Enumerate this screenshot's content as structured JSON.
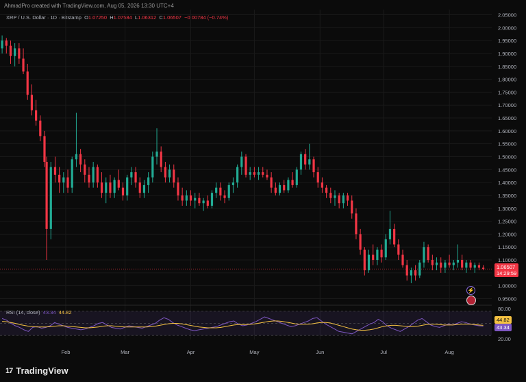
{
  "credit": "AhmadPro created with TradingView.com, Aug 05, 2026 13:30 UTC+4",
  "legend": {
    "symbol": "XRP / U.S. Dollar · 1D · Bitstamp",
    "o_label": "O",
    "o": "1.07250",
    "h_label": "H",
    "h": "1.07584",
    "l_label": "L",
    "l": "1.06312",
    "c_label": "C",
    "c": "1.06507",
    "change": "−0.00784 (−0.74%)"
  },
  "price_badge": {
    "price": "1.06507",
    "countdown": "14:29:59"
  },
  "rsi": {
    "label": "RSI (14, close)",
    "rsi_value": "43.34",
    "ma_value": "44.82",
    "axis_ticks": [
      "80.00",
      "20.00"
    ]
  },
  "brand": {
    "logo": "17",
    "name": "TradingView"
  },
  "icons": {
    "flash": "flash-icon",
    "flag": "us-flag-icon"
  },
  "colors": {
    "up": "#22ab94",
    "down": "#f23645",
    "rsi": "#7e57c2",
    "rsi_ma": "#f5c242",
    "background": "#0b0b0b"
  },
  "chart_data": {
    "type": "candlestick",
    "price_axis_ticks": [
      "2.05000",
      "2.00000",
      "1.95000",
      "1.90000",
      "1.85000",
      "1.80000",
      "1.75000",
      "1.70000",
      "1.65000",
      "1.60000",
      "1.55000",
      "1.50000",
      "1.45000",
      "1.40000",
      "1.35000",
      "1.30000",
      "1.25000",
      "1.20000",
      "1.15000",
      "1.10000",
      "1.05000",
      "1.00000",
      "0.95000"
    ],
    "price_range": [
      0.93,
      2.07
    ],
    "x_axis_labels": [
      "Feb",
      "Mar",
      "Apr",
      "May",
      "Jun",
      "Jul",
      "Aug"
    ],
    "x_label_days": [
      31,
      59,
      90,
      120,
      151,
      181,
      212
    ],
    "x_range_days": [
      0,
      232
    ],
    "last_close": 1.06507,
    "candles": [
      {
        "d": 1,
        "o": 1.92,
        "h": 1.97,
        "l": 1.9,
        "c": 1.95
      },
      {
        "d": 3,
        "o": 1.95,
        "h": 1.96,
        "l": 1.9,
        "c": 1.93
      },
      {
        "d": 5,
        "o": 1.93,
        "h": 1.95,
        "l": 1.86,
        "c": 1.89
      },
      {
        "d": 7,
        "o": 1.89,
        "h": 1.94,
        "l": 1.85,
        "c": 1.92
      },
      {
        "d": 9,
        "o": 1.92,
        "h": 1.94,
        "l": 1.86,
        "c": 1.88
      },
      {
        "d": 11,
        "o": 1.88,
        "h": 1.92,
        "l": 1.82,
        "c": 1.83
      },
      {
        "d": 13,
        "o": 1.83,
        "h": 1.86,
        "l": 1.72,
        "c": 1.74
      },
      {
        "d": 15,
        "o": 1.74,
        "h": 1.78,
        "l": 1.66,
        "c": 1.68
      },
      {
        "d": 17,
        "o": 1.68,
        "h": 1.72,
        "l": 1.62,
        "c": 1.64
      },
      {
        "d": 19,
        "o": 1.64,
        "h": 1.66,
        "l": 1.56,
        "c": 1.58
      },
      {
        "d": 21,
        "o": 1.58,
        "h": 1.6,
        "l": 1.46,
        "c": 1.48
      },
      {
        "d": 22,
        "o": 1.48,
        "h": 1.5,
        "l": 1.1,
        "c": 1.22
      },
      {
        "d": 24,
        "o": 1.22,
        "h": 1.48,
        "l": 1.18,
        "c": 1.46
      },
      {
        "d": 26,
        "o": 1.46,
        "h": 1.5,
        "l": 1.4,
        "c": 1.43
      },
      {
        "d": 28,
        "o": 1.43,
        "h": 1.46,
        "l": 1.36,
        "c": 1.4
      },
      {
        "d": 30,
        "o": 1.4,
        "h": 1.44,
        "l": 1.36,
        "c": 1.42
      },
      {
        "d": 32,
        "o": 1.42,
        "h": 1.45,
        "l": 1.36,
        "c": 1.38
      },
      {
        "d": 34,
        "o": 1.38,
        "h": 1.5,
        "l": 1.36,
        "c": 1.49
      },
      {
        "d": 36,
        "o": 1.49,
        "h": 1.67,
        "l": 1.46,
        "c": 1.51
      },
      {
        "d": 38,
        "o": 1.51,
        "h": 1.53,
        "l": 1.44,
        "c": 1.47
      },
      {
        "d": 40,
        "o": 1.47,
        "h": 1.49,
        "l": 1.4,
        "c": 1.43
      },
      {
        "d": 42,
        "o": 1.43,
        "h": 1.46,
        "l": 1.38,
        "c": 1.4
      },
      {
        "d": 44,
        "o": 1.4,
        "h": 1.48,
        "l": 1.38,
        "c": 1.46
      },
      {
        "d": 46,
        "o": 1.46,
        "h": 1.47,
        "l": 1.38,
        "c": 1.4
      },
      {
        "d": 48,
        "o": 1.4,
        "h": 1.44,
        "l": 1.34,
        "c": 1.36
      },
      {
        "d": 50,
        "o": 1.36,
        "h": 1.42,
        "l": 1.32,
        "c": 1.4
      },
      {
        "d": 52,
        "o": 1.4,
        "h": 1.43,
        "l": 1.34,
        "c": 1.36
      },
      {
        "d": 54,
        "o": 1.36,
        "h": 1.42,
        "l": 1.34,
        "c": 1.41
      },
      {
        "d": 56,
        "o": 1.41,
        "h": 1.45,
        "l": 1.37,
        "c": 1.38
      },
      {
        "d": 58,
        "o": 1.38,
        "h": 1.4,
        "l": 1.33,
        "c": 1.35
      },
      {
        "d": 60,
        "o": 1.35,
        "h": 1.43,
        "l": 1.33,
        "c": 1.42
      },
      {
        "d": 62,
        "o": 1.42,
        "h": 1.46,
        "l": 1.39,
        "c": 1.44
      },
      {
        "d": 64,
        "o": 1.44,
        "h": 1.46,
        "l": 1.38,
        "c": 1.4
      },
      {
        "d": 66,
        "o": 1.4,
        "h": 1.42,
        "l": 1.34,
        "c": 1.36
      },
      {
        "d": 68,
        "o": 1.36,
        "h": 1.41,
        "l": 1.34,
        "c": 1.39
      },
      {
        "d": 70,
        "o": 1.39,
        "h": 1.44,
        "l": 1.36,
        "c": 1.42
      },
      {
        "d": 72,
        "o": 1.42,
        "h": 1.52,
        "l": 1.4,
        "c": 1.5
      },
      {
        "d": 74,
        "o": 1.5,
        "h": 1.61,
        "l": 1.47,
        "c": 1.52
      },
      {
        "d": 76,
        "o": 1.52,
        "h": 1.54,
        "l": 1.44,
        "c": 1.46
      },
      {
        "d": 78,
        "o": 1.46,
        "h": 1.48,
        "l": 1.4,
        "c": 1.42
      },
      {
        "d": 80,
        "o": 1.42,
        "h": 1.47,
        "l": 1.4,
        "c": 1.45
      },
      {
        "d": 82,
        "o": 1.45,
        "h": 1.47,
        "l": 1.38,
        "c": 1.4
      },
      {
        "d": 84,
        "o": 1.4,
        "h": 1.42,
        "l": 1.33,
        "c": 1.35
      },
      {
        "d": 86,
        "o": 1.35,
        "h": 1.38,
        "l": 1.31,
        "c": 1.33
      },
      {
        "d": 88,
        "o": 1.33,
        "h": 1.37,
        "l": 1.31,
        "c": 1.35
      },
      {
        "d": 90,
        "o": 1.35,
        "h": 1.37,
        "l": 1.31,
        "c": 1.33
      },
      {
        "d": 92,
        "o": 1.33,
        "h": 1.36,
        "l": 1.3,
        "c": 1.34
      },
      {
        "d": 94,
        "o": 1.34,
        "h": 1.36,
        "l": 1.31,
        "c": 1.32
      },
      {
        "d": 96,
        "o": 1.32,
        "h": 1.34,
        "l": 1.29,
        "c": 1.33
      },
      {
        "d": 98,
        "o": 1.33,
        "h": 1.35,
        "l": 1.3,
        "c": 1.31
      },
      {
        "d": 100,
        "o": 1.31,
        "h": 1.37,
        "l": 1.3,
        "c": 1.36
      },
      {
        "d": 102,
        "o": 1.36,
        "h": 1.4,
        "l": 1.34,
        "c": 1.38
      },
      {
        "d": 104,
        "o": 1.38,
        "h": 1.4,
        "l": 1.33,
        "c": 1.35
      },
      {
        "d": 106,
        "o": 1.35,
        "h": 1.37,
        "l": 1.32,
        "c": 1.34
      },
      {
        "d": 108,
        "o": 1.34,
        "h": 1.4,
        "l": 1.33,
        "c": 1.39
      },
      {
        "d": 110,
        "o": 1.39,
        "h": 1.42,
        "l": 1.36,
        "c": 1.4
      },
      {
        "d": 112,
        "o": 1.4,
        "h": 1.47,
        "l": 1.38,
        "c": 1.46
      },
      {
        "d": 114,
        "o": 1.46,
        "h": 1.52,
        "l": 1.43,
        "c": 1.5
      },
      {
        "d": 116,
        "o": 1.5,
        "h": 1.51,
        "l": 1.42,
        "c": 1.43
      },
      {
        "d": 118,
        "o": 1.43,
        "h": 1.46,
        "l": 1.41,
        "c": 1.44
      },
      {
        "d": 120,
        "o": 1.44,
        "h": 1.46,
        "l": 1.42,
        "c": 1.43
      },
      {
        "d": 122,
        "o": 1.43,
        "h": 1.46,
        "l": 1.41,
        "c": 1.44
      },
      {
        "d": 124,
        "o": 1.44,
        "h": 1.46,
        "l": 1.42,
        "c": 1.43
      },
      {
        "d": 126,
        "o": 1.43,
        "h": 1.45,
        "l": 1.41,
        "c": 1.42
      },
      {
        "d": 128,
        "o": 1.42,
        "h": 1.44,
        "l": 1.36,
        "c": 1.38
      },
      {
        "d": 130,
        "o": 1.38,
        "h": 1.4,
        "l": 1.35,
        "c": 1.36
      },
      {
        "d": 132,
        "o": 1.36,
        "h": 1.4,
        "l": 1.35,
        "c": 1.39
      },
      {
        "d": 134,
        "o": 1.39,
        "h": 1.41,
        "l": 1.36,
        "c": 1.37
      },
      {
        "d": 136,
        "o": 1.37,
        "h": 1.42,
        "l": 1.36,
        "c": 1.41
      },
      {
        "d": 138,
        "o": 1.41,
        "h": 1.44,
        "l": 1.38,
        "c": 1.39
      },
      {
        "d": 140,
        "o": 1.39,
        "h": 1.46,
        "l": 1.38,
        "c": 1.45
      },
      {
        "d": 142,
        "o": 1.45,
        "h": 1.52,
        "l": 1.43,
        "c": 1.51
      },
      {
        "d": 144,
        "o": 1.51,
        "h": 1.53,
        "l": 1.45,
        "c": 1.47
      },
      {
        "d": 146,
        "o": 1.47,
        "h": 1.55,
        "l": 1.45,
        "c": 1.49
      },
      {
        "d": 148,
        "o": 1.49,
        "h": 1.5,
        "l": 1.42,
        "c": 1.44
      },
      {
        "d": 150,
        "o": 1.44,
        "h": 1.46,
        "l": 1.38,
        "c": 1.4
      },
      {
        "d": 152,
        "o": 1.4,
        "h": 1.42,
        "l": 1.36,
        "c": 1.38
      },
      {
        "d": 154,
        "o": 1.38,
        "h": 1.39,
        "l": 1.34,
        "c": 1.36
      },
      {
        "d": 156,
        "o": 1.36,
        "h": 1.38,
        "l": 1.32,
        "c": 1.34
      },
      {
        "d": 158,
        "o": 1.34,
        "h": 1.37,
        "l": 1.31,
        "c": 1.35
      },
      {
        "d": 160,
        "o": 1.35,
        "h": 1.36,
        "l": 1.3,
        "c": 1.32
      },
      {
        "d": 162,
        "o": 1.32,
        "h": 1.36,
        "l": 1.3,
        "c": 1.35
      },
      {
        "d": 164,
        "o": 1.35,
        "h": 1.36,
        "l": 1.31,
        "c": 1.33
      },
      {
        "d": 166,
        "o": 1.33,
        "h": 1.35,
        "l": 1.26,
        "c": 1.28
      },
      {
        "d": 168,
        "o": 1.28,
        "h": 1.3,
        "l": 1.18,
        "c": 1.2
      },
      {
        "d": 170,
        "o": 1.2,
        "h": 1.22,
        "l": 1.12,
        "c": 1.14
      },
      {
        "d": 172,
        "o": 1.14,
        "h": 1.15,
        "l": 1.04,
        "c": 1.06
      },
      {
        "d": 174,
        "o": 1.06,
        "h": 1.14,
        "l": 1.05,
        "c": 1.12
      },
      {
        "d": 176,
        "o": 1.12,
        "h": 1.16,
        "l": 1.08,
        "c": 1.1
      },
      {
        "d": 178,
        "o": 1.1,
        "h": 1.15,
        "l": 1.08,
        "c": 1.14
      },
      {
        "d": 180,
        "o": 1.14,
        "h": 1.16,
        "l": 1.09,
        "c": 1.11
      },
      {
        "d": 182,
        "o": 1.11,
        "h": 1.2,
        "l": 1.1,
        "c": 1.18
      },
      {
        "d": 184,
        "o": 1.18,
        "h": 1.29,
        "l": 1.16,
        "c": 1.22
      },
      {
        "d": 186,
        "o": 1.22,
        "h": 1.24,
        "l": 1.15,
        "c": 1.16
      },
      {
        "d": 188,
        "o": 1.16,
        "h": 1.18,
        "l": 1.1,
        "c": 1.12
      },
      {
        "d": 190,
        "o": 1.12,
        "h": 1.14,
        "l": 1.07,
        "c": 1.08
      },
      {
        "d": 192,
        "o": 1.08,
        "h": 1.1,
        "l": 1.02,
        "c": 1.04
      },
      {
        "d": 194,
        "o": 1.04,
        "h": 1.07,
        "l": 1.01,
        "c": 1.06
      },
      {
        "d": 196,
        "o": 1.06,
        "h": 1.08,
        "l": 1.02,
        "c": 1.04
      },
      {
        "d": 198,
        "o": 1.04,
        "h": 1.1,
        "l": 1.03,
        "c": 1.09
      },
      {
        "d": 200,
        "o": 1.09,
        "h": 1.17,
        "l": 1.07,
        "c": 1.15
      },
      {
        "d": 202,
        "o": 1.15,
        "h": 1.16,
        "l": 1.09,
        "c": 1.1
      },
      {
        "d": 204,
        "o": 1.1,
        "h": 1.12,
        "l": 1.06,
        "c": 1.08
      },
      {
        "d": 206,
        "o": 1.08,
        "h": 1.11,
        "l": 1.06,
        "c": 1.09
      },
      {
        "d": 208,
        "o": 1.09,
        "h": 1.11,
        "l": 1.05,
        "c": 1.07
      },
      {
        "d": 210,
        "o": 1.07,
        "h": 1.1,
        "l": 1.05,
        "c": 1.09
      },
      {
        "d": 212,
        "o": 1.09,
        "h": 1.12,
        "l": 1.07,
        "c": 1.08
      },
      {
        "d": 214,
        "o": 1.08,
        "h": 1.1,
        "l": 1.06,
        "c": 1.09
      },
      {
        "d": 216,
        "o": 1.09,
        "h": 1.16,
        "l": 1.07,
        "c": 1.1
      },
      {
        "d": 218,
        "o": 1.1,
        "h": 1.12,
        "l": 1.06,
        "c": 1.07
      },
      {
        "d": 220,
        "o": 1.07,
        "h": 1.1,
        "l": 1.05,
        "c": 1.09
      },
      {
        "d": 222,
        "o": 1.09,
        "h": 1.1,
        "l": 1.06,
        "c": 1.07
      },
      {
        "d": 224,
        "o": 1.07,
        "h": 1.09,
        "l": 1.05,
        "c": 1.08
      },
      {
        "d": 226,
        "o": 1.08,
        "h": 1.09,
        "l": 1.06,
        "c": 1.07
      },
      {
        "d": 228,
        "o": 1.07,
        "h": 1.08,
        "l": 1.06,
        "c": 1.065
      }
    ],
    "rsi_series": [
      62,
      58,
      50,
      44,
      40,
      34,
      30,
      40,
      42,
      38,
      40,
      44,
      52,
      48,
      44,
      40,
      38,
      36,
      34,
      36,
      40,
      44,
      50,
      52,
      46,
      40,
      38,
      36,
      40,
      44,
      42,
      40,
      38,
      42,
      46,
      50,
      58,
      64,
      60,
      52,
      46,
      42,
      38,
      34,
      32,
      34,
      36,
      38,
      40,
      42,
      46,
      50,
      54,
      56,
      48,
      44,
      46,
      50,
      54,
      60,
      66,
      62,
      58,
      54,
      50,
      46,
      42,
      44,
      48,
      52,
      56,
      62,
      64,
      56,
      48,
      42,
      36,
      30,
      28,
      26,
      24,
      30,
      36,
      42,
      48,
      52,
      60,
      54,
      44,
      38,
      34,
      30,
      36,
      42,
      50,
      58,
      62,
      54,
      46,
      42,
      40,
      44,
      48,
      46,
      50,
      54,
      52,
      48,
      46,
      44,
      43
    ],
    "rsi_ma_series": [
      55,
      54,
      52,
      50,
      47,
      45,
      43,
      42,
      41,
      41,
      41,
      42,
      43,
      44,
      44,
      43,
      42,
      41,
      40,
      39,
      39,
      40,
      41,
      43,
      44,
      44,
      43,
      42,
      41,
      41,
      41,
      41,
      41,
      41,
      42,
      43,
      45,
      47,
      49,
      50,
      50,
      49,
      47,
      45,
      43,
      41,
      40,
      39,
      39,
      39,
      40,
      42,
      44,
      46,
      47,
      47,
      47,
      48,
      49,
      51,
      53,
      55,
      56,
      56,
      55,
      53,
      51,
      49,
      48,
      48,
      48,
      49,
      51,
      52,
      52,
      51,
      48,
      45,
      42,
      39,
      36,
      34,
      33,
      33,
      34,
      36,
      39,
      42,
      44,
      45,
      45,
      44,
      43,
      42,
      42,
      43,
      45,
      47,
      48,
      48,
      47,
      46,
      46,
      46,
      47,
      48,
      48,
      48,
      47,
      46,
      45
    ]
  }
}
